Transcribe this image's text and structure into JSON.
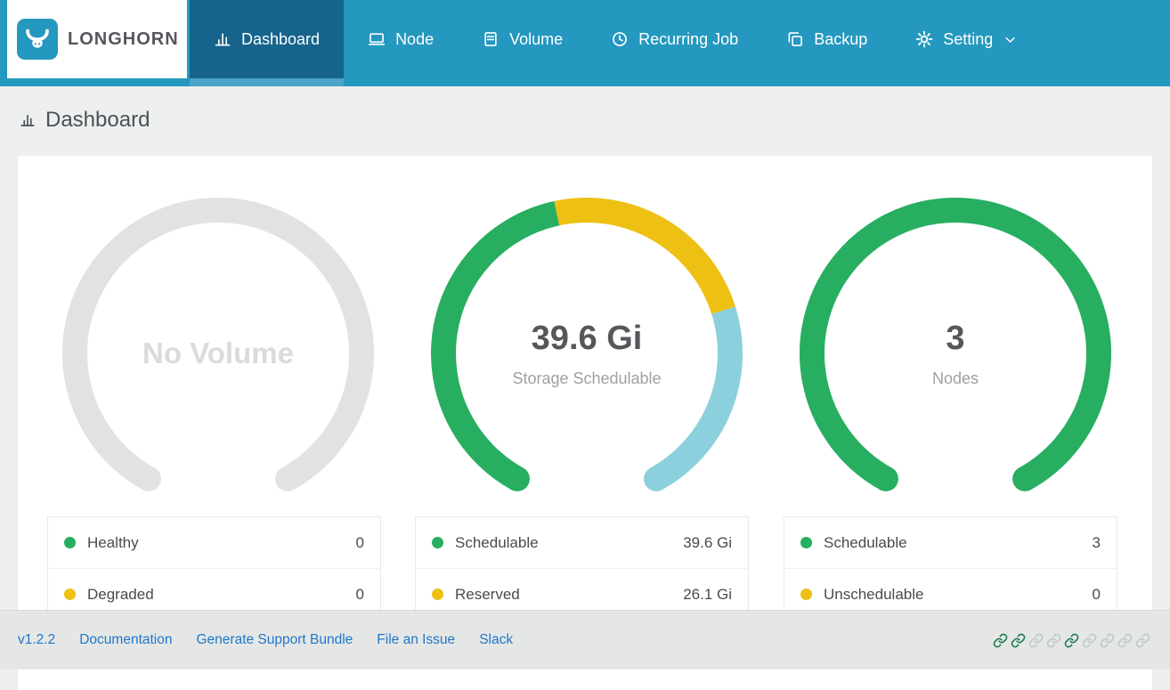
{
  "header": {
    "brand": "LONGHORN",
    "nav": [
      {
        "label": "Dashboard",
        "active": true
      },
      {
        "label": "Node"
      },
      {
        "label": "Volume"
      },
      {
        "label": "Recurring Job"
      },
      {
        "label": "Backup"
      },
      {
        "label": "Setting",
        "has_dropdown": true
      }
    ]
  },
  "page": {
    "title": "Dashboard"
  },
  "panels": [
    {
      "id": "volume",
      "gauge": {
        "center_title": "No Volume",
        "segments": [
          {
            "name": "empty",
            "color": "#e2e2e2",
            "fraction": 1
          }
        ]
      },
      "legend": [
        {
          "label": "Healthy",
          "color": "#27ae60",
          "value": "0"
        },
        {
          "label": "Degraded",
          "color": "#edc013",
          "value": "0"
        }
      ]
    },
    {
      "id": "storage",
      "gauge": {
        "center_value": "39.6 Gi",
        "center_label": "Storage Schedulable",
        "segments": [
          {
            "name": "schedulable",
            "color": "#27ae60",
            "fraction": 0.46
          },
          {
            "name": "reserved",
            "color": "#edc013",
            "fraction": 0.28
          },
          {
            "name": "other",
            "color": "#8bd0dc",
            "fraction": 0.26
          }
        ]
      },
      "legend": [
        {
          "label": "Schedulable",
          "color": "#27ae60",
          "value": "39.6 Gi"
        },
        {
          "label": "Reserved",
          "color": "#edc013",
          "value": "26.1 Gi"
        }
      ]
    },
    {
      "id": "nodes",
      "gauge": {
        "center_value": "3",
        "center_label": "Nodes",
        "segments": [
          {
            "name": "schedulable",
            "color": "#27ae60",
            "fraction": 1
          }
        ]
      },
      "legend": [
        {
          "label": "Schedulable",
          "color": "#27ae60",
          "value": "3"
        },
        {
          "label": "Unschedulable",
          "color": "#edc013",
          "value": "0"
        }
      ]
    }
  ],
  "chart_data": [
    {
      "type": "pie",
      "variant": "gauge",
      "title": "No Volume",
      "slices": [
        {
          "label": "empty",
          "fraction": 1,
          "color": "#e2e2e2"
        }
      ]
    },
    {
      "type": "pie",
      "variant": "gauge",
      "title": "Storage Schedulable",
      "center_value": "39.6 Gi",
      "slices": [
        {
          "label": "schedulable",
          "fraction": 0.46,
          "color": "#27ae60"
        },
        {
          "label": "reserved",
          "fraction": 0.28,
          "color": "#edc013"
        },
        {
          "label": "other",
          "fraction": 0.26,
          "color": "#8bd0dc"
        }
      ]
    },
    {
      "type": "pie",
      "variant": "gauge",
      "title": "Nodes",
      "center_value": "3",
      "slices": [
        {
          "label": "schedulable",
          "fraction": 1,
          "color": "#27ae60"
        }
      ]
    }
  ],
  "footer": {
    "version": "v1.2.2",
    "links": [
      "Documentation",
      "Generate Support Bundle",
      "File an Issue",
      "Slack"
    ],
    "link_icons": [
      "active",
      "active",
      "inactive",
      "inactive",
      "active",
      "inactive",
      "inactive",
      "inactive",
      "inactive"
    ],
    "icon_colors": {
      "active": "#18794b",
      "inactive": "#bdc8c3"
    }
  },
  "colors": {
    "header": "#2498bf",
    "active_tab": "#16648c",
    "active_tab_strip": "#4aa5c7",
    "green": "#27ae60",
    "yellow": "#edc013",
    "cyan": "#8bd0dc",
    "empty_ring": "#e2e2e2",
    "link_blue": "#2277c8"
  }
}
